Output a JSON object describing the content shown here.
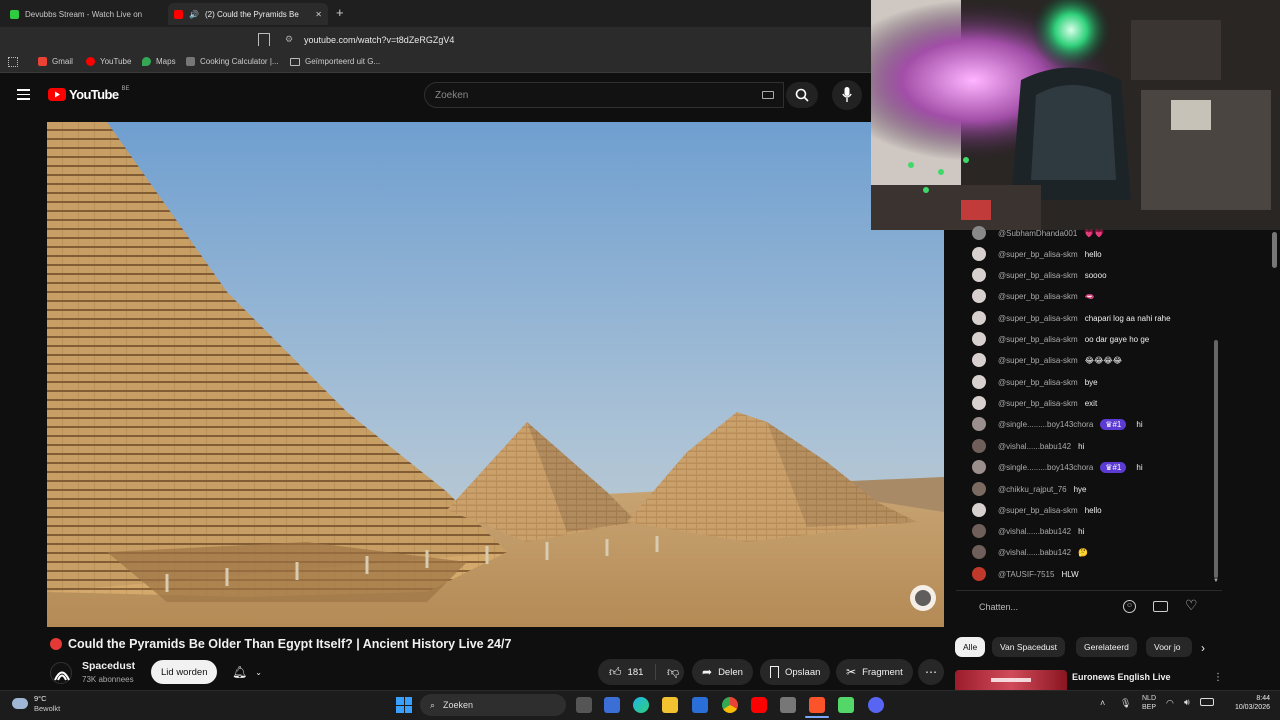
{
  "browser": {
    "tabs": [
      {
        "label": "Devubbs Stream - Watch Live on"
      },
      {
        "label": "(2)  Could the Pyramids Be",
        "active": true
      }
    ],
    "new_tab": "+",
    "url": "youtube.com/watch?v=t8dZeRGZgV4",
    "bookmarks": [
      "Gmail",
      "YouTube",
      "Maps",
      "Cooking Calculator |...",
      "Geïmporteerd uit G..."
    ]
  },
  "yt": {
    "logo_text": "YouTube",
    "region": "BE",
    "search_placeholder": "Zoeken"
  },
  "video": {
    "title": "Could the Pyramids Be Older Than Egypt Itself? | Ancient History Live 24/7",
    "channel": "Spacedust",
    "subscribers": "73K abonnees",
    "join_label": "Lid worden",
    "likes": "181",
    "share_label": "Delen",
    "save_label": "Opslaan",
    "clip_label": "Fragment"
  },
  "chat": {
    "messages": [
      {
        "user": "@SubhamDhanda001",
        "text": "",
        "emoji": "💗💗"
      },
      {
        "user": "@super_bp_alisa-skm",
        "text": "hello"
      },
      {
        "user": "@super_bp_alisa-skm",
        "text": "soooo"
      },
      {
        "user": "@super_bp_alisa-skm",
        "text": "",
        "emoji": "🫦"
      },
      {
        "user": "@super_bp_alisa-skm",
        "text": "chapari log aa nahi rahe"
      },
      {
        "user": "@super_bp_alisa-skm",
        "text": "oo dar gaye ho ge"
      },
      {
        "user": "@super_bp_alisa-skm",
        "text": "",
        "emoji": "😂😂😂😂"
      },
      {
        "user": "@super_bp_alisa-skm",
        "text": "bye"
      },
      {
        "user": "@super_bp_alisa-skm",
        "text": "exit"
      },
      {
        "user": "@single.........boy143chora",
        "text": "hi",
        "badge": "#1"
      },
      {
        "user": "@vishal......babu142",
        "text": "hi"
      },
      {
        "user": "@single.........boy143chora",
        "text": "hi",
        "badge": "#1"
      },
      {
        "user": "@chikku_rajput_76",
        "text": "hye"
      },
      {
        "user": "@super_bp_alisa-skm",
        "text": "hello"
      },
      {
        "user": "@vishal......babu142",
        "text": "hi"
      },
      {
        "user": "@vishal......babu142",
        "text": "",
        "emoji": "🤔"
      },
      {
        "user": "@TAUSIF-7515",
        "text": "HLW"
      }
    ],
    "input_placeholder": "Chatten..."
  },
  "related": {
    "chips": [
      "Alle",
      "Van Spacedust",
      "Gerelateerd",
      "Voor jo"
    ],
    "first_item": "Euronews English Live"
  },
  "taskbar": {
    "weather_temp": "9°C",
    "weather_desc": "Bewolkt",
    "search": "Zoeken",
    "lang1": "NLD",
    "lang2": "BEP",
    "time": "8:44",
    "date": "10/03/2026"
  },
  "colors": {
    "accent_red": "#ff0000",
    "live_red": "#e53935",
    "background": "#0f0f0f",
    "badge_purple": "#5b3bd1"
  }
}
